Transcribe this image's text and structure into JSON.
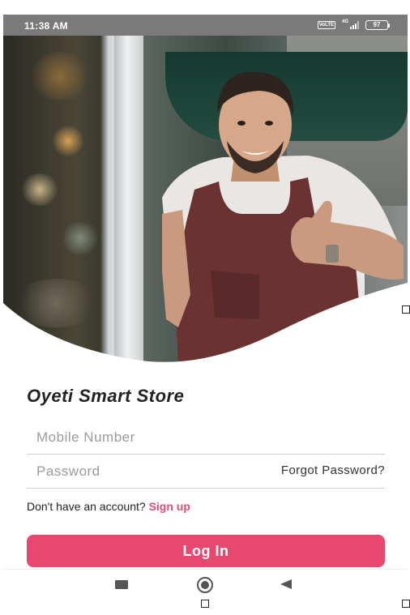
{
  "status_bar": {
    "time": "11:38 AM",
    "network_label": "4G",
    "battery_level": "97",
    "icons": [
      "volte-icon",
      "signal-icon",
      "battery-icon"
    ]
  },
  "hero": {
    "description_icon": "shopkeeper-photo"
  },
  "login": {
    "title": "Oyeti Smart Store",
    "mobile_placeholder": "Mobile Number",
    "password_placeholder": "Password",
    "forgot_password": "Forgot Password?",
    "no_account_text": "Don't have an account?",
    "signup_link": "Sign up",
    "login_button": "Log In"
  },
  "nav_bar": {
    "icons": [
      "recent-apps-icon",
      "home-icon",
      "back-icon"
    ]
  },
  "colors": {
    "accent": "#e8476f",
    "signup_link": "#e24a74",
    "status_bar": "#7a7a7a",
    "title": "#222222"
  }
}
